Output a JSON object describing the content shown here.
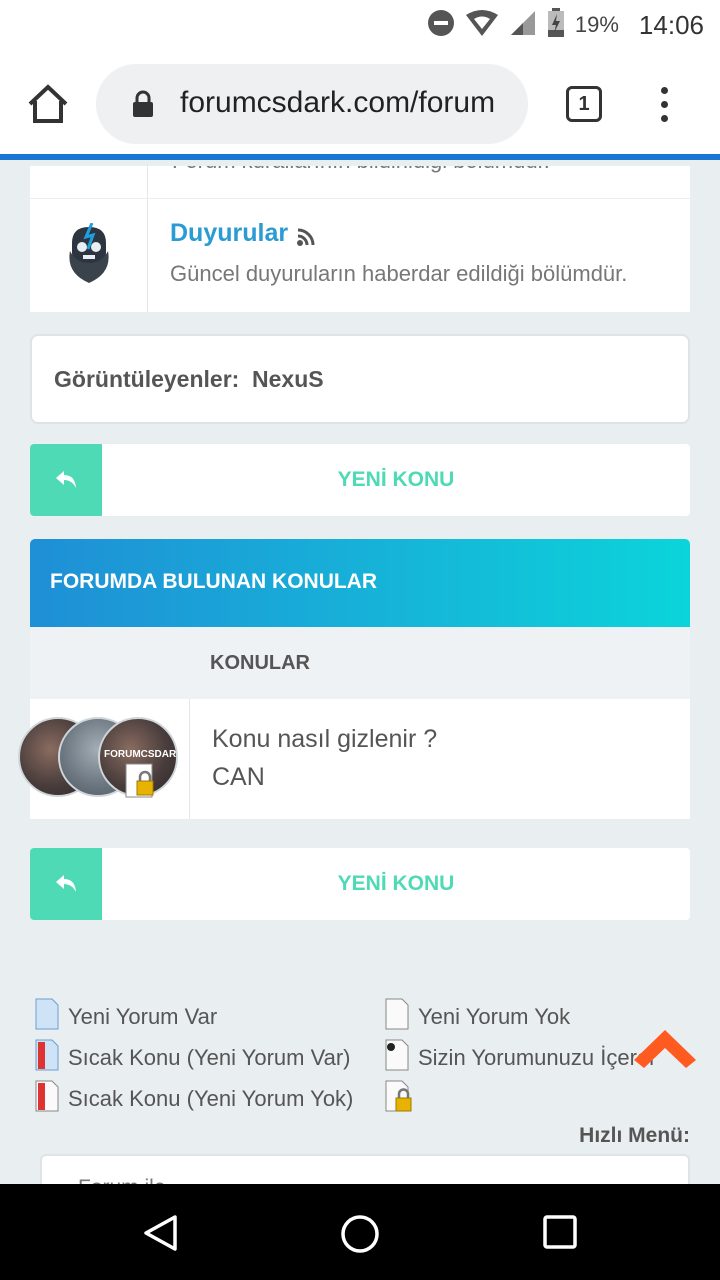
{
  "status_bar": {
    "battery_pct": "19%",
    "time": "14:06",
    "icons": [
      "do-not-disturb-icon",
      "wifi-icon",
      "signal-icon",
      "battery-charging-icon"
    ]
  },
  "browser": {
    "url": "forumcsdark.com/forum",
    "tab_count": "1",
    "icons": [
      "home-icon",
      "lock-icon",
      "tabs-icon",
      "more-vert-icon"
    ]
  },
  "forum": {
    "partial_row": {
      "desc": "Forum kurallarının bildirildiği bölümdür."
    },
    "announcements": {
      "title": "Duyurular",
      "desc": "Güncel duyuruların haberdar edildiği bölümdür.",
      "icon": "skull-logo-icon"
    }
  },
  "viewers": {
    "label": "Görüntüleyenler:",
    "user": "NexuS"
  },
  "new_topic": {
    "label": "YENİ KONU"
  },
  "topics": {
    "header": "FORUMDA BULUNAN KONULAR",
    "column": "KONULAR",
    "rows": [
      {
        "title": "Konu nasıl gizlenir ?",
        "author": "CAN",
        "avatar_watermark": "FORUMCSDARK"
      }
    ]
  },
  "legend": {
    "items": [
      {
        "label": "Yeni Yorum Var",
        "icon": "new-file-icon"
      },
      {
        "label": "Yeni Yorum Yok",
        "icon": "file-icon"
      },
      {
        "label": "Sıcak Konu (Yeni Yorum Var)",
        "icon": "hot-file-icon"
      },
      {
        "label": "Sizin Yorumunuzu İçeren",
        "icon": "dot-file-icon"
      },
      {
        "label": "Sıcak Konu (Yeni Yorum Yok)",
        "icon": "hot-file-icon"
      },
      {
        "label": "",
        "icon": "locked-file-icon"
      }
    ]
  },
  "quick_menu": {
    "label": "Hızlı Menü:",
    "selected": "Forum ile"
  },
  "colors": {
    "accent_green": "#4fdab6",
    "link_blue": "#2a9bd3",
    "header_gradient_start": "#1f8fd6",
    "header_gradient_end": "#0bd4da",
    "scroll_top_orange": "#ff5a1f"
  }
}
